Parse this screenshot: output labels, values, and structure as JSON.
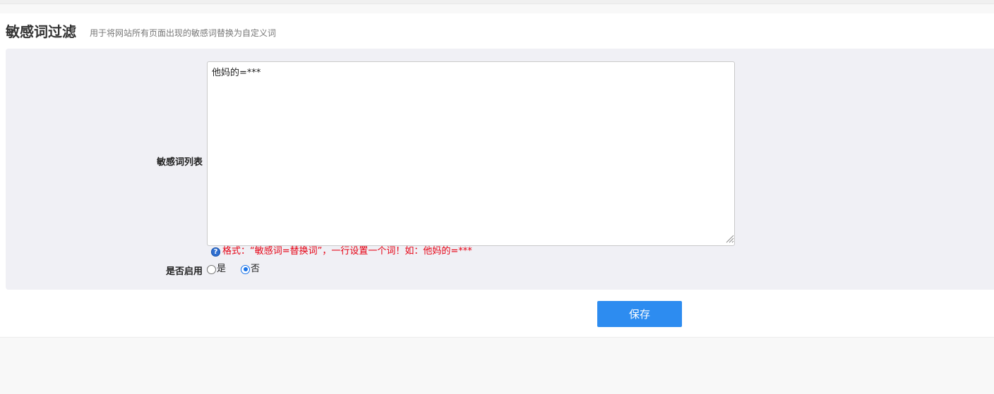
{
  "header": {
    "title": "敏感词过滤",
    "subtitle": "用于将网站所有页面出现的敏感词替换为自定义词"
  },
  "form": {
    "words_label": "敏感词列表",
    "words_value": "他妈的=***",
    "hint_icon": "question-icon",
    "hint_text": "格式：“敏感词=替换词”，一行设置一个词！如：他妈的=***",
    "enable_label": "是否启用",
    "enable_options": [
      {
        "label": "是",
        "checked": false
      },
      {
        "label": "否",
        "checked": true
      }
    ]
  },
  "actions": {
    "save_label": "保存"
  },
  "colors": {
    "accent": "#2d8cf0",
    "hint": "#e60012",
    "form_background": "#f0f0f5"
  }
}
